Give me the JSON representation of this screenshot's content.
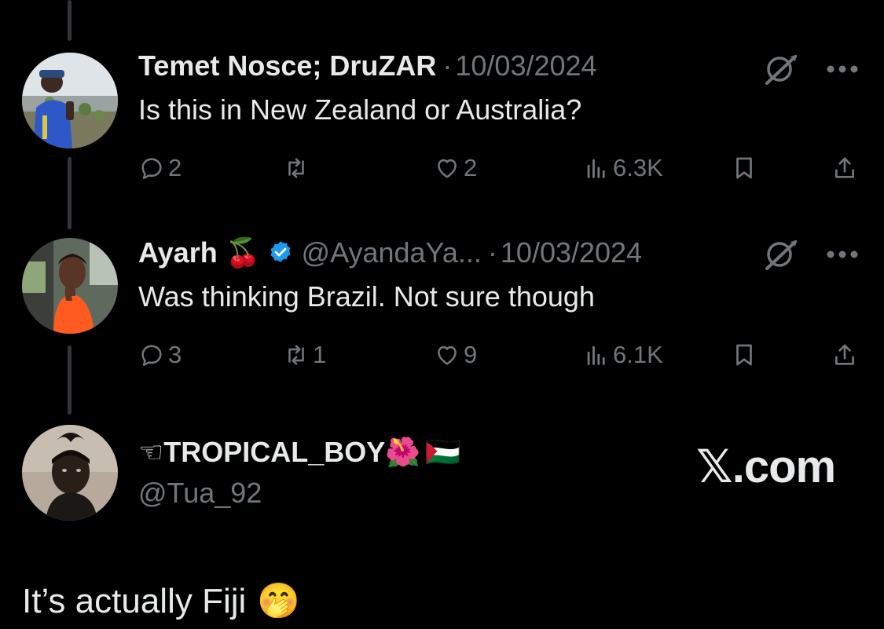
{
  "colors": {
    "background": "#000000",
    "text_primary": "#e7e9ea",
    "text_muted": "#71767b",
    "verified_blue": "#1d9bf0",
    "thread_line": "#333639"
  },
  "replies": [
    {
      "display_name": "Temet Nosce; DruZAR",
      "handle": "",
      "separator": "·",
      "date": "10/03/2024",
      "text": "Is this in New Zealand or Australia?",
      "actions": {
        "reply_count": "2",
        "repost_count": "",
        "like_count": "2",
        "view_count": "6.3K"
      },
      "icons": [
        "grok-icon",
        "more-icon",
        "reply-icon",
        "repost-icon",
        "like-icon",
        "views-icon",
        "bookmark-icon",
        "share-icon"
      ]
    },
    {
      "display_name": "Ayarh",
      "name_emoji": "🍒",
      "verified": true,
      "handle": "@AyandaYa...",
      "separator": "·",
      "date": "10/03/2024",
      "text": "Was thinking Brazil. Not sure though",
      "actions": {
        "reply_count": "3",
        "repost_count": "1",
        "like_count": "9",
        "view_count": "6.1K"
      },
      "icons": [
        "grok-icon",
        "more-icon",
        "reply-icon",
        "repost-icon",
        "like-icon",
        "views-icon",
        "bookmark-icon",
        "share-icon"
      ]
    }
  ],
  "main_post": {
    "display_name_prefix": "☜",
    "display_name": "TROPICAL_BOY",
    "name_emojis": [
      "🌺",
      "🇵🇸"
    ],
    "handle": "@Tua_92",
    "text": "It’s actually Fiji",
    "text_emoji": "🤭"
  },
  "watermark": "𝕏.com"
}
